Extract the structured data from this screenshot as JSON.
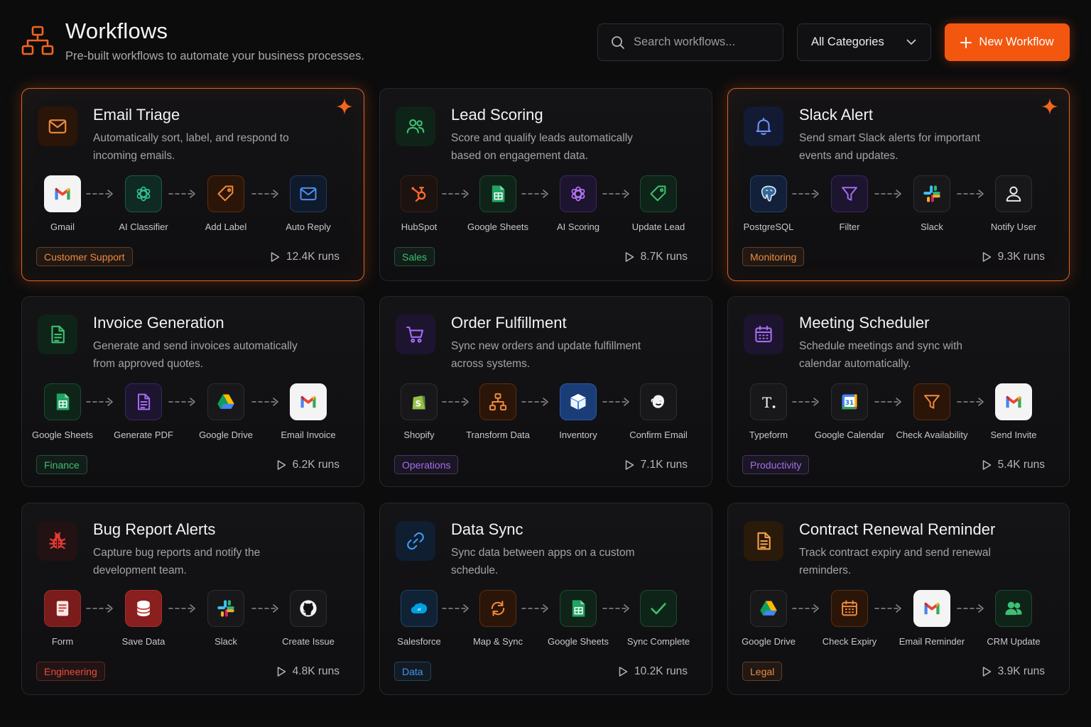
{
  "header": {
    "title": "Workflows",
    "subtitle": "Pre-built workflows to automate your business processes.",
    "search_placeholder": "Search workflows...",
    "category_label": "All Categories",
    "new_button_label": "New Workflow"
  },
  "colors": {
    "accent": "#f3560f",
    "background": "#0c0c0d",
    "card_border": "#26262b"
  },
  "cards": [
    {
      "title": "Email Triage",
      "description": "Automatically sort, label, and respond to incoming emails.",
      "icon": "envelope-icon",
      "featured": true,
      "steps": [
        {
          "label": "Gmail",
          "icon": "gmail-icon"
        },
        {
          "label": "AI Classifier",
          "icon": "openai-icon"
        },
        {
          "label": "Add Label",
          "icon": "tag-icon"
        },
        {
          "label": "Auto Reply",
          "icon": "envelope-icon"
        }
      ],
      "tag": "Customer Support",
      "tag_color": "#f08a3c",
      "runs": "12.4K runs"
    },
    {
      "title": "Lead Scoring",
      "description": "Score and qualify leads automatically based on engagement data.",
      "icon": "users-icon",
      "featured": false,
      "steps": [
        {
          "label": "HubSpot",
          "icon": "hubspot-icon"
        },
        {
          "label": "Google Sheets",
          "icon": "sheets-icon"
        },
        {
          "label": "AI Scoring",
          "icon": "openai-icon"
        },
        {
          "label": "Update Lead",
          "icon": "tag-icon"
        }
      ],
      "tag": "Sales",
      "tag_color": "#3fbf72",
      "runs": "8.7K runs"
    },
    {
      "title": "Slack Alert",
      "description": "Send smart Slack alerts for important events and updates.",
      "icon": "bell-icon",
      "featured": true,
      "steps": [
        {
          "label": "PostgreSQL",
          "icon": "postgresql-icon"
        },
        {
          "label": "Filter",
          "icon": "filter-icon"
        },
        {
          "label": "Slack",
          "icon": "slack-icon"
        },
        {
          "label": "Notify User",
          "icon": "user-icon"
        }
      ],
      "tag": "Monitoring",
      "tag_color": "#f08a3c",
      "runs": "9.3K runs"
    },
    {
      "title": "Invoice Generation",
      "description": "Generate and send invoices automatically from approved quotes.",
      "icon": "document-icon",
      "featured": false,
      "steps": [
        {
          "label": "Google Sheets",
          "icon": "sheets-icon"
        },
        {
          "label": "Generate PDF",
          "icon": "document-icon"
        },
        {
          "label": "Google Drive",
          "icon": "drive-icon"
        },
        {
          "label": "Email Invoice",
          "icon": "gmail-icon"
        }
      ],
      "tag": "Finance",
      "tag_color": "#3fbf72",
      "runs": "6.2K runs"
    },
    {
      "title": "Order Fulfillment",
      "description": "Sync new orders and update fulfillment across systems.",
      "icon": "cart-icon",
      "featured": false,
      "steps": [
        {
          "label": "Shopify",
          "icon": "shopify-icon"
        },
        {
          "label": "Transform Data",
          "icon": "workflow-icon"
        },
        {
          "label": "Inventory",
          "icon": "box-icon"
        },
        {
          "label": "Confirm Email",
          "icon": "mailchimp-icon"
        }
      ],
      "tag": "Operations",
      "tag_color": "#a46cf0",
      "runs": "7.1K runs"
    },
    {
      "title": "Meeting Scheduler",
      "description": "Schedule meetings and sync with calendar automatically.",
      "icon": "calendar-icon",
      "featured": false,
      "steps": [
        {
          "label": "Typeform",
          "icon": "typeform-icon"
        },
        {
          "label": "Google Calendar",
          "icon": "google-calendar-icon"
        },
        {
          "label": "Check Availability",
          "icon": "filter-icon"
        },
        {
          "label": "Send Invite",
          "icon": "gmail-icon"
        }
      ],
      "tag": "Productivity",
      "tag_color": "#a46cf0",
      "runs": "5.4K runs"
    },
    {
      "title": "Bug Report Alerts",
      "description": "Capture bug reports and notify the development team.",
      "icon": "bug-icon",
      "featured": false,
      "steps": [
        {
          "label": "Form",
          "icon": "form-icon"
        },
        {
          "label": "Save Data",
          "icon": "database-icon"
        },
        {
          "label": "Slack",
          "icon": "slack-icon"
        },
        {
          "label": "Create Issue",
          "icon": "github-icon"
        }
      ],
      "tag": "Engineering",
      "tag_color": "#ee4d3a",
      "runs": "4.8K runs"
    },
    {
      "title": "Data Sync",
      "description": "Sync data between apps on a custom schedule.",
      "icon": "link-icon",
      "featured": false,
      "steps": [
        {
          "label": "Salesforce",
          "icon": "salesforce-icon"
        },
        {
          "label": "Map & Sync",
          "icon": "refresh-icon"
        },
        {
          "label": "Google Sheets",
          "icon": "sheets-icon"
        },
        {
          "label": "Sync Complete",
          "icon": "check-icon"
        }
      ],
      "tag": "Data",
      "tag_color": "#3d97f0",
      "runs": "10.2K runs"
    },
    {
      "title": "Contract Renewal Reminder",
      "description": "Track contract expiry and send renewal reminders.",
      "icon": "contract-icon",
      "featured": false,
      "steps": [
        {
          "label": "Google Drive",
          "icon": "drive-icon"
        },
        {
          "label": "Check Expiry",
          "icon": "calendar-icon"
        },
        {
          "label": "Email Reminder",
          "icon": "gmail-icon"
        },
        {
          "label": "CRM Update",
          "icon": "users-icon"
        }
      ],
      "tag": "Legal",
      "tag_color": "#f08a3c",
      "runs": "3.9K runs"
    }
  ]
}
